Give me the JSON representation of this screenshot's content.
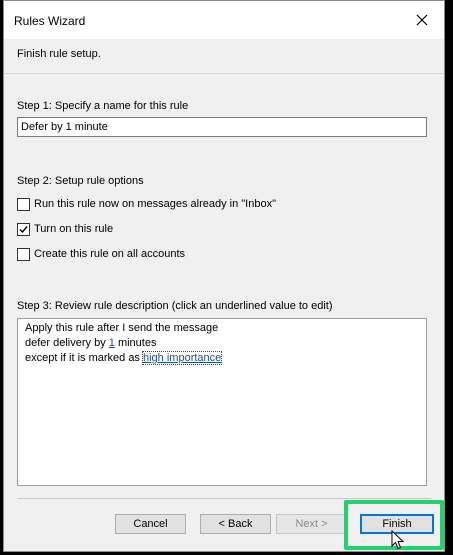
{
  "window": {
    "title": "Rules Wizard"
  },
  "header": "Finish rule setup.",
  "step1": {
    "label": "Step 1: Specify a name for this rule",
    "rule_name": "Defer by 1 minute"
  },
  "step2": {
    "label": "Step 2: Setup rule options",
    "options": [
      {
        "label": "Run this rule now on messages already in \"Inbox\"",
        "checked": false
      },
      {
        "label": "Turn on this rule",
        "checked": true
      },
      {
        "label": "Create this rule on all accounts",
        "checked": false
      }
    ]
  },
  "step3": {
    "label": "Step 3: Review rule description (click an underlined value to edit)",
    "line1": "Apply this rule after I send the message",
    "line2_prefix": "defer delivery by ",
    "line2_link": "1",
    "line2_suffix": " minutes",
    "line3_prefix": "except if it is marked as ",
    "line3_link": "high importance"
  },
  "buttons": {
    "cancel": "Cancel",
    "back": "< Back",
    "next": "Next >",
    "finish": "Finish"
  },
  "colors": {
    "highlight": "#22d26c",
    "link": "#1f4e9c"
  }
}
